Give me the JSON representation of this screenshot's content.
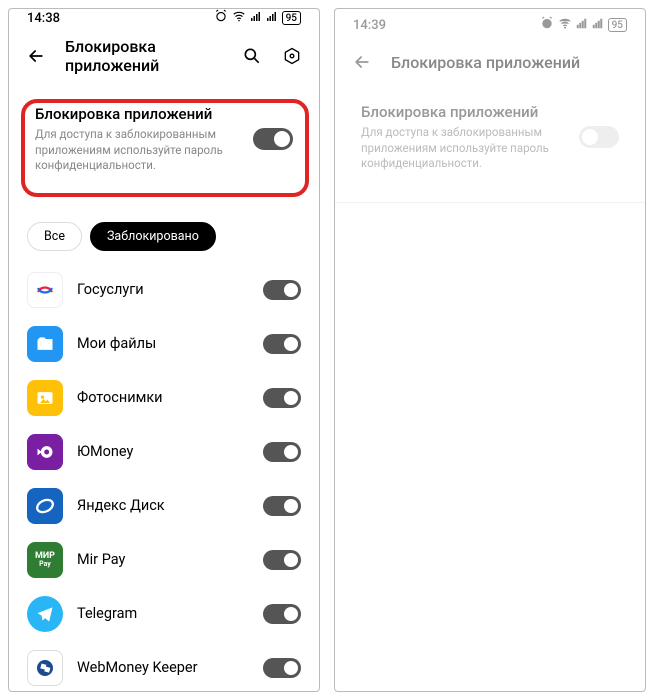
{
  "left": {
    "status": {
      "time": "14:38",
      "battery": "95"
    },
    "header": {
      "title": "Блокировка приложений"
    },
    "master": {
      "title": "Блокировка приложений",
      "subtitle": "Для доступа к заблокированным приложениям используйте пароль конфиденциальности.",
      "enabled": true
    },
    "chips": {
      "all": "Все",
      "locked": "Заблокировано"
    },
    "apps": [
      {
        "name": "Госуслуги"
      },
      {
        "name": "Мои файлы"
      },
      {
        "name": "Фотоснимки"
      },
      {
        "name": "ЮMoney"
      },
      {
        "name": "Яндекс Диск"
      },
      {
        "name": "Mir Pay"
      },
      {
        "name": "Telegram"
      },
      {
        "name": "WebMoney Keeper"
      }
    ]
  },
  "right": {
    "status": {
      "time": "14:39",
      "battery": "95"
    },
    "header": {
      "title": "Блокировка приложений"
    },
    "master": {
      "title": "Блокировка приложений",
      "subtitle": "Для доступа к заблокированным приложениям используйте пароль конфиденциальности.",
      "enabled": false
    }
  },
  "icons": {
    "gosuslugi": {
      "bg": "#fff",
      "border": "#eee"
    },
    "files": {
      "bg": "#2196f3"
    },
    "photos": {
      "bg": "#ffc107"
    },
    "yoomoney": {
      "bg": "#7b1fa2"
    },
    "yadisk": {
      "bg": "#1565c0"
    },
    "mirpay": {
      "bg": "#2e7d32"
    },
    "telegram": {
      "bg": "#29b6f6"
    },
    "webmoney": {
      "bg": "#fff",
      "border": "#ddd"
    }
  }
}
